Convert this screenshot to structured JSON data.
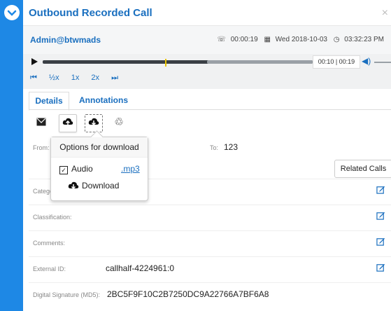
{
  "window": {
    "title": "Outbound Recorded Call",
    "close_glyph": "×"
  },
  "subheader": {
    "user": "Admin@btwmads",
    "duration": "00:00:19",
    "date": "Wed 2018-10-03",
    "time": "03:32:23 PM"
  },
  "player": {
    "time_display": "00:10 | 00:19",
    "progress_fraction": 0.53,
    "speeds": [
      "½x",
      "1x",
      "2x"
    ]
  },
  "tabs": {
    "details": "Details",
    "annotations": "Annotations"
  },
  "fields": {
    "from_label": "From:",
    "to_label": "To:",
    "to_value": "123",
    "related_calls": "Related Calls",
    "category_label": "Catego",
    "classification_label": "Classification:",
    "comments_label": "Comments:",
    "external_id_label": "External ID:",
    "external_id_value": "callhalf-4224961:0",
    "signature_label": "Digital Signature (MD5):",
    "signature_value": "2BC5F9F10C2B7250DC9A22766A7BF6A8"
  },
  "popover": {
    "title": "Options for download",
    "audio_label": "Audio",
    "audio_ext": ".mp3",
    "download_label": "Download"
  },
  "colors": {
    "accent": "#1a6fbf",
    "sidebar": "#1e88e5"
  }
}
